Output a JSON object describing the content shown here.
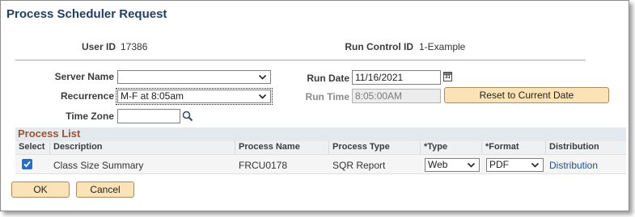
{
  "page": {
    "title": "Process Scheduler Request"
  },
  "header": {
    "user_id_label": "User ID",
    "user_id_value": "17386",
    "run_control_label": "Run Control ID",
    "run_control_value": "1-Example"
  },
  "form": {
    "server_name_label": "Server Name",
    "server_name_value": "",
    "recurrence_label": "Recurrence",
    "recurrence_value": "M-F at 8:05am",
    "time_zone_label": "Time Zone",
    "time_zone_value": "",
    "run_date_label": "Run Date",
    "run_date_value": "11/16/2021",
    "calendar_glyph": "31",
    "run_time_label": "Run Time",
    "run_time_value": "8:05:00AM",
    "reset_button_label": "Reset to Current Date"
  },
  "process_list": {
    "title": "Process List",
    "columns": [
      "Select",
      "Description",
      "Process Name",
      "Process Type",
      "*Type",
      "*Format",
      "Distribution"
    ],
    "rows": [
      {
        "selected": true,
        "description": "Class Size Summary",
        "process_name": "FRCU0178",
        "process_type": "SQR Report",
        "type": "Web",
        "format": "PDF",
        "distribution": "Distribution"
      }
    ]
  },
  "actions": {
    "ok_label": "OK",
    "cancel_label": "Cancel"
  },
  "icons": {
    "dropdown": "chevron-down-icon",
    "lookup": "magnifier-icon",
    "calendar": "calendar-icon",
    "checkbox": "checkmark-icon"
  },
  "colors": {
    "title": "#1f3f6b",
    "section_title": "#a0522d",
    "button_bg": "#fce3b6",
    "checkbox": "#1f6fd1",
    "link": "#1f4e8c"
  }
}
